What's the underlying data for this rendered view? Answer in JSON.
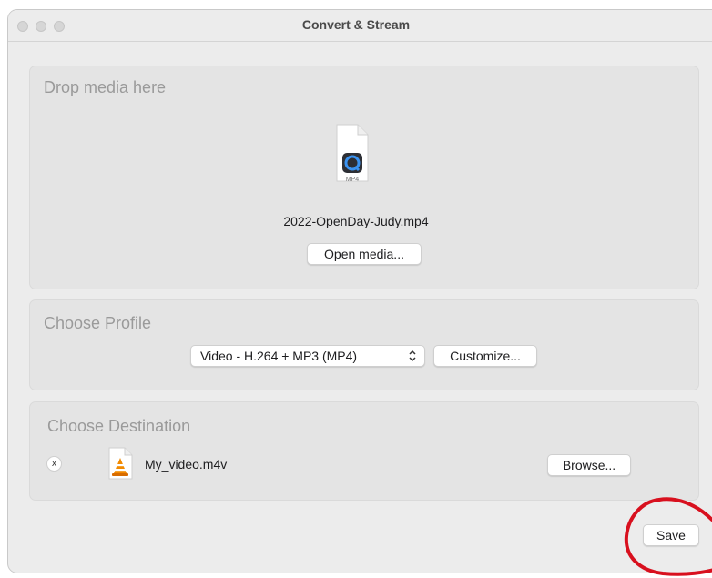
{
  "window": {
    "title": "Convert & Stream"
  },
  "drop": {
    "heading": "Drop media here",
    "file_type": "MP4",
    "file_name": "2022-OpenDay-Judy.mp4",
    "open_button": "Open media..."
  },
  "profile": {
    "heading": "Choose Profile",
    "selected": "Video - H.264 + MP3 (MP4)",
    "customize_button": "Customize..."
  },
  "destination": {
    "heading": "Choose Destination",
    "remove_label": "x",
    "file_name": "My_video.m4v",
    "browse_button": "Browse..."
  },
  "footer": {
    "save_button": "Save"
  },
  "colors": {
    "annotation": "#d8101e",
    "window_bg": "#ececec",
    "panel_bg": "#e4e4e4"
  },
  "icons": [
    "traffic-light-icon",
    "quicktime-file-icon",
    "vlc-cone-icon",
    "chevron-updown-icon"
  ]
}
